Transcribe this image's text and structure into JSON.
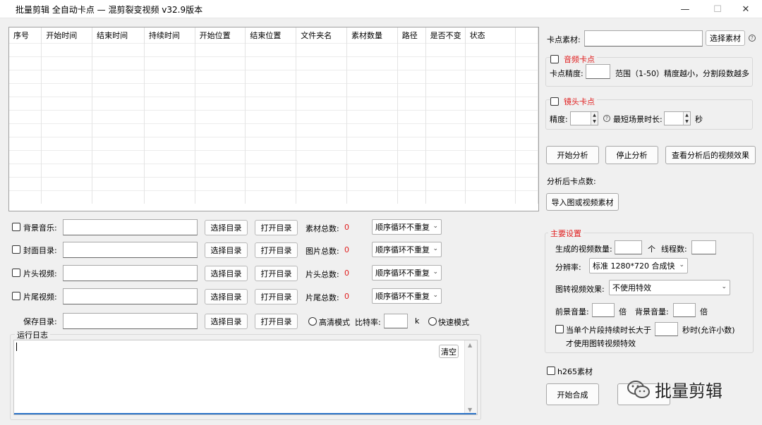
{
  "window": {
    "title": "批量剪辑  全自动卡点 — 混剪裂变视频  v32.9版本",
    "minimize": "—",
    "maximize": "☐",
    "close": "✕"
  },
  "grid": {
    "columns": [
      "序号",
      "开始时间",
      "结束时间",
      "持续时间",
      "开始位置",
      "结束位置",
      "文件夹名",
      "素材数量",
      "路径",
      "是否不变",
      "状态"
    ]
  },
  "rows": {
    "bgm": {
      "label": "背景音乐:",
      "select": "选择目录",
      "open": "打开目录",
      "count_label": "素材总数:",
      "count": "0",
      "mode": "顺序循环不重复"
    },
    "cover": {
      "label": "封面目录:",
      "select": "选择目录",
      "open": "打开目录",
      "count_label": "图片总数:",
      "count": "0",
      "mode": "顺序循环不重复"
    },
    "intro": {
      "label": "片头视频:",
      "select": "选择目录",
      "open": "打开目录",
      "count_label": "片头总数:",
      "count": "0",
      "mode": "顺序循环不重复"
    },
    "outro": {
      "label": "片尾视频:",
      "select": "选择目录",
      "open": "打开目录",
      "count_label": "片尾总数:",
      "count": "0",
      "mode": "顺序循环不重复"
    },
    "save": {
      "label": "保存目录:",
      "select": "选择目录",
      "open": "打开目录",
      "hd_label": "高清模式",
      "bitrate_label": "比特率:",
      "bitrate_unit": "k",
      "fast_label": "快速模式"
    }
  },
  "log": {
    "title": "运行日志",
    "clear": "清空"
  },
  "right": {
    "beat_material_label": "卡点素材:",
    "choose_material": "选择素材",
    "audio_group": "音频卡点",
    "precision_label": "卡点精度:",
    "precision_hint": "范围（1-50）精度越小，分割段数越多",
    "shot_group": "镜头卡点",
    "shot_precision_label": "精度:",
    "min_scene_label": "最短场景时长:",
    "seconds": "秒",
    "start_analyze": "开始分析",
    "stop_analyze": "停止分析",
    "view_result": "查看分析后的视频效果",
    "beat_count_label": "分析后卡点数:",
    "import_material": "导入图或视频素材"
  },
  "main_settings": {
    "title": "主要设置",
    "video_count_label": "生成的视频数量:",
    "unit": "个",
    "threads_label": "线程数:",
    "resolution_label": "分辨率:",
    "resolution": "标准 1280*720 合成快",
    "img_effect_label": "图转视频效果:",
    "img_effect": "不使用特效",
    "fg_volume_label": "前景音量:",
    "fg_unit": "倍",
    "bg_volume_label": "背景音量:",
    "bg_unit": "倍",
    "cond_label_1": "当单个片段持续时长大于",
    "cond_label_2": "秒时(允许小数)",
    "cond_label_3": "才使用图转视频特效"
  },
  "bottom": {
    "h265_label": "h265素材",
    "start_compose": "开始合成",
    "watermark": "批量剪辑"
  },
  "icons": {
    "help": "?",
    "spin_up": "▲",
    "spin_down": "▼",
    "dropdown": "⌄"
  }
}
